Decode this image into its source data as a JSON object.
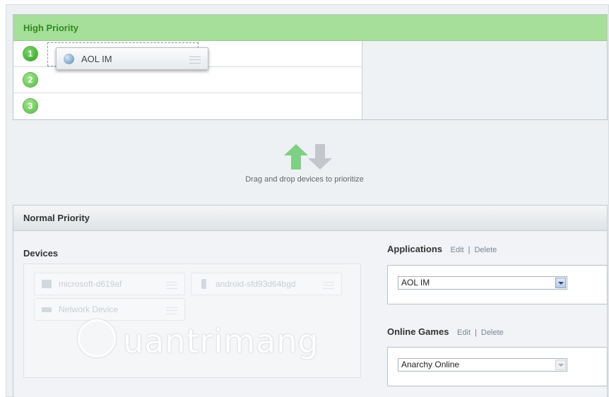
{
  "high_priority": {
    "title": "High Priority",
    "slots": [
      {
        "number": "1",
        "item": "AOL IM"
      },
      {
        "number": "2",
        "item": ""
      },
      {
        "number": "3",
        "item": ""
      }
    ]
  },
  "hint": "Drag and drop devices to prioritize",
  "normal_priority": {
    "title": "Normal Priority",
    "devices": {
      "title": "Devices",
      "items": [
        {
          "label": "microsoft-d619af",
          "icon": "computer-icon"
        },
        {
          "label": "android-sfd93d64bgd",
          "icon": "phone-icon"
        },
        {
          "label": "Network Device",
          "icon": "network-device-icon"
        }
      ]
    },
    "applications": {
      "title": "Applications",
      "edit": "Edit",
      "separator": "|",
      "delete": "Delete",
      "selected": "AOL IM"
    },
    "online_games": {
      "title": "Online Games",
      "edit": "Edit",
      "separator": "|",
      "delete": "Delete",
      "selected": "Anarchy Online"
    }
  },
  "colors": {
    "high_header_bg": "#a6df9a",
    "high_header_text": "#2d8a20",
    "arrow_green": "#7fcf84",
    "arrow_gray": "#c3c7cc"
  }
}
